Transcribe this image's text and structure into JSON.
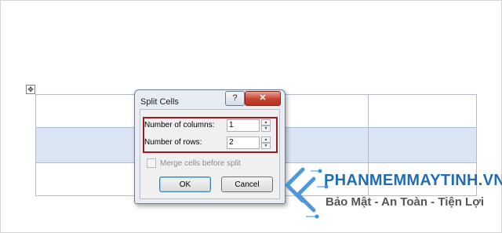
{
  "dialog": {
    "title": "Split Cells",
    "help_glyph": "?",
    "close_glyph": "✕",
    "columns_label": "Number of columns:",
    "columns_value": "1",
    "rows_label": "Number of rows:",
    "rows_value": "2",
    "merge_label": "Merge cells before split",
    "merge_checked": false,
    "merge_enabled": false,
    "ok_label": "OK",
    "cancel_label": "Cancel"
  },
  "table_move_handle_glyph": "✥",
  "watermark": {
    "brand": "PHANMEMMAYTINH.VN",
    "tagline": "Bảo Mật - An Toàn - Tiện Lợi"
  },
  "colors": {
    "highlight": "#9e1b24",
    "selected_row": "#dae5f4",
    "brand_blue": "#1f6db5"
  }
}
